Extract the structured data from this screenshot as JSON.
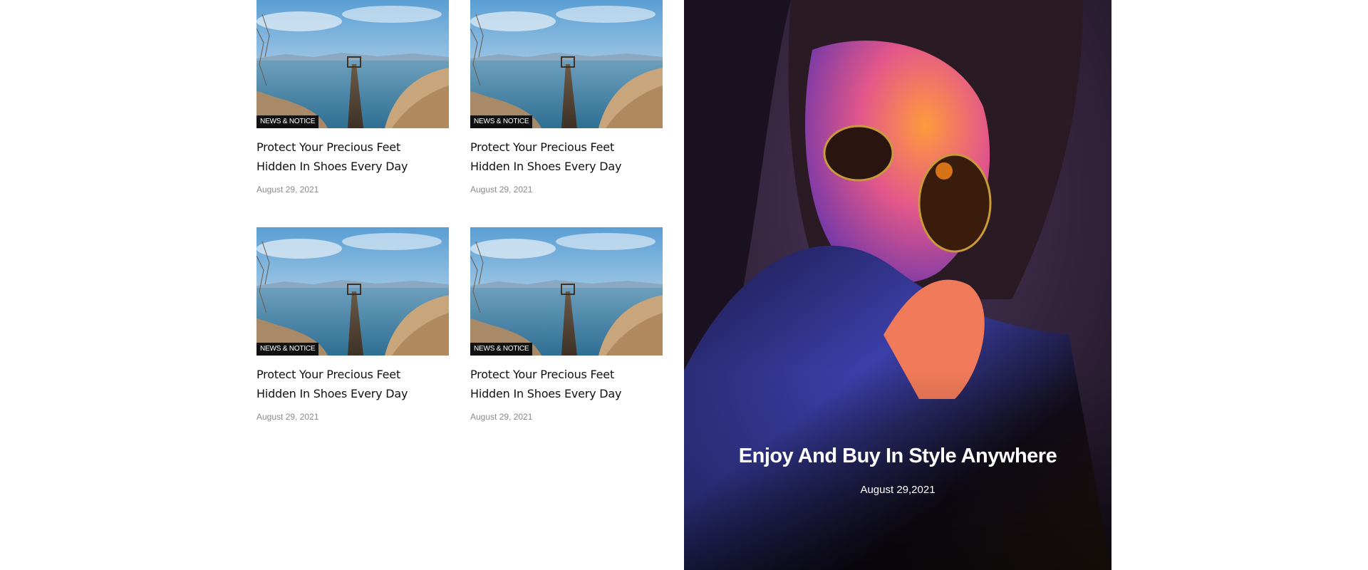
{
  "posts": [
    {
      "badge": "NEWS & NOTICE",
      "title": "Protect Your Precious Feet Hidden In Shoes Every Day",
      "date": "August 29, 2021"
    },
    {
      "badge": "NEWS & NOTICE",
      "title": "Protect Your Precious Feet Hidden In Shoes Every Day",
      "date": "August 29, 2021"
    },
    {
      "badge": "NEWS & NOTICE",
      "title": "Protect Your Precious Feet Hidden In Shoes Every Day",
      "date": "August 29, 2021"
    },
    {
      "badge": "NEWS & NOTICE",
      "title": "Protect Your Precious Feet Hidden In Shoes Every Day",
      "date": "August 29, 2021"
    }
  ],
  "promo": {
    "title": "Enjoy And Buy In Style Anywhere",
    "date": "August 29,2021"
  },
  "colors": {
    "badge_bg": "#111111",
    "title_text": "#111111",
    "date_text": "#8a8a8a",
    "promo_bg": "#2a1d33",
    "promo_text": "#ffffff"
  }
}
